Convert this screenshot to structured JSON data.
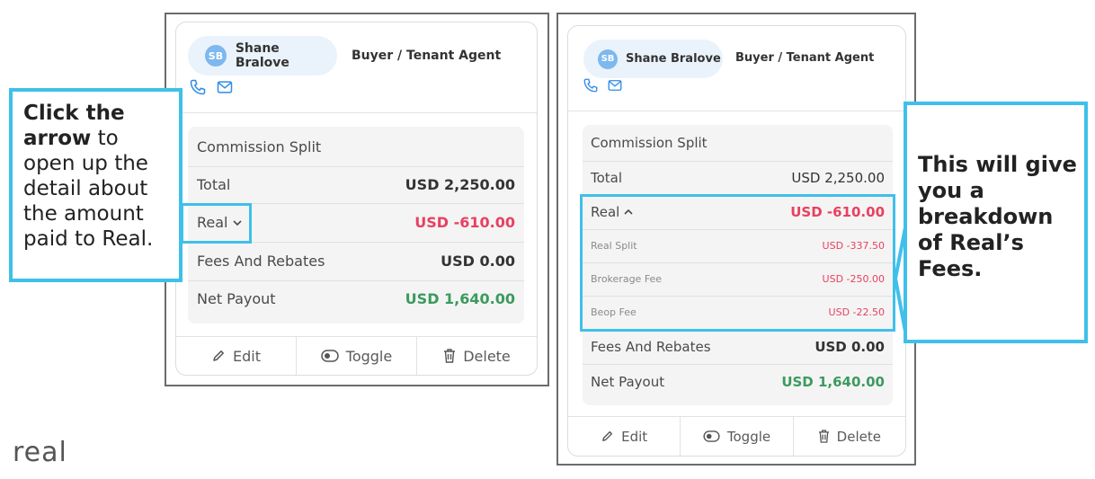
{
  "cards": [
    {
      "agent": {
        "initials": "SB",
        "name": "Shane Bralove",
        "role": "Buyer / Tenant Agent"
      },
      "section_title": "Commission Split",
      "total": {
        "label": "Total",
        "value": "USD 2,250.00"
      },
      "real": {
        "label": "Real",
        "chevron": "chevron-down-icon",
        "value": "USD -610.00"
      },
      "fees": {
        "label": "Fees And Rebates",
        "value": "USD 0.00"
      },
      "net": {
        "label": "Net Payout",
        "value": "USD 1,640.00"
      },
      "footer": {
        "edit": "Edit",
        "toggle": "Toggle",
        "delete": "Delete"
      }
    },
    {
      "agent": {
        "initials": "SB",
        "name": "Shane Bralove",
        "role": "Buyer / Tenant Agent"
      },
      "section_title": "Commission Split",
      "total": {
        "label": "Total",
        "value": "USD 2,250.00"
      },
      "real": {
        "label": "Real",
        "chevron": "chevron-up-icon",
        "value": "USD -610.00"
      },
      "breakdown": [
        {
          "label": "Real Split",
          "value": "USD -337.50"
        },
        {
          "label": "Brokerage Fee",
          "value": "USD -250.00"
        },
        {
          "label": "Beop Fee",
          "value": "USD -22.50"
        }
      ],
      "fees": {
        "label": "Fees And Rebates",
        "value": "USD 0.00"
      },
      "net": {
        "label": "Net Payout",
        "value": "USD 1,640.00"
      },
      "footer": {
        "edit": "Edit",
        "toggle": "Toggle",
        "delete": "Delete"
      }
    }
  ],
  "callout_left": {
    "bold": "Click the arrow",
    "rest": " to open up the detail about the amount paid to Real."
  },
  "callout_right": "This will give you a breakdown of Real’s Fees.",
  "logo": "real",
  "colors": {
    "accent": "#3fc0ea",
    "negative": "#e8405f",
    "positive": "#3c9a5f",
    "avatar": "#7db8ee"
  }
}
